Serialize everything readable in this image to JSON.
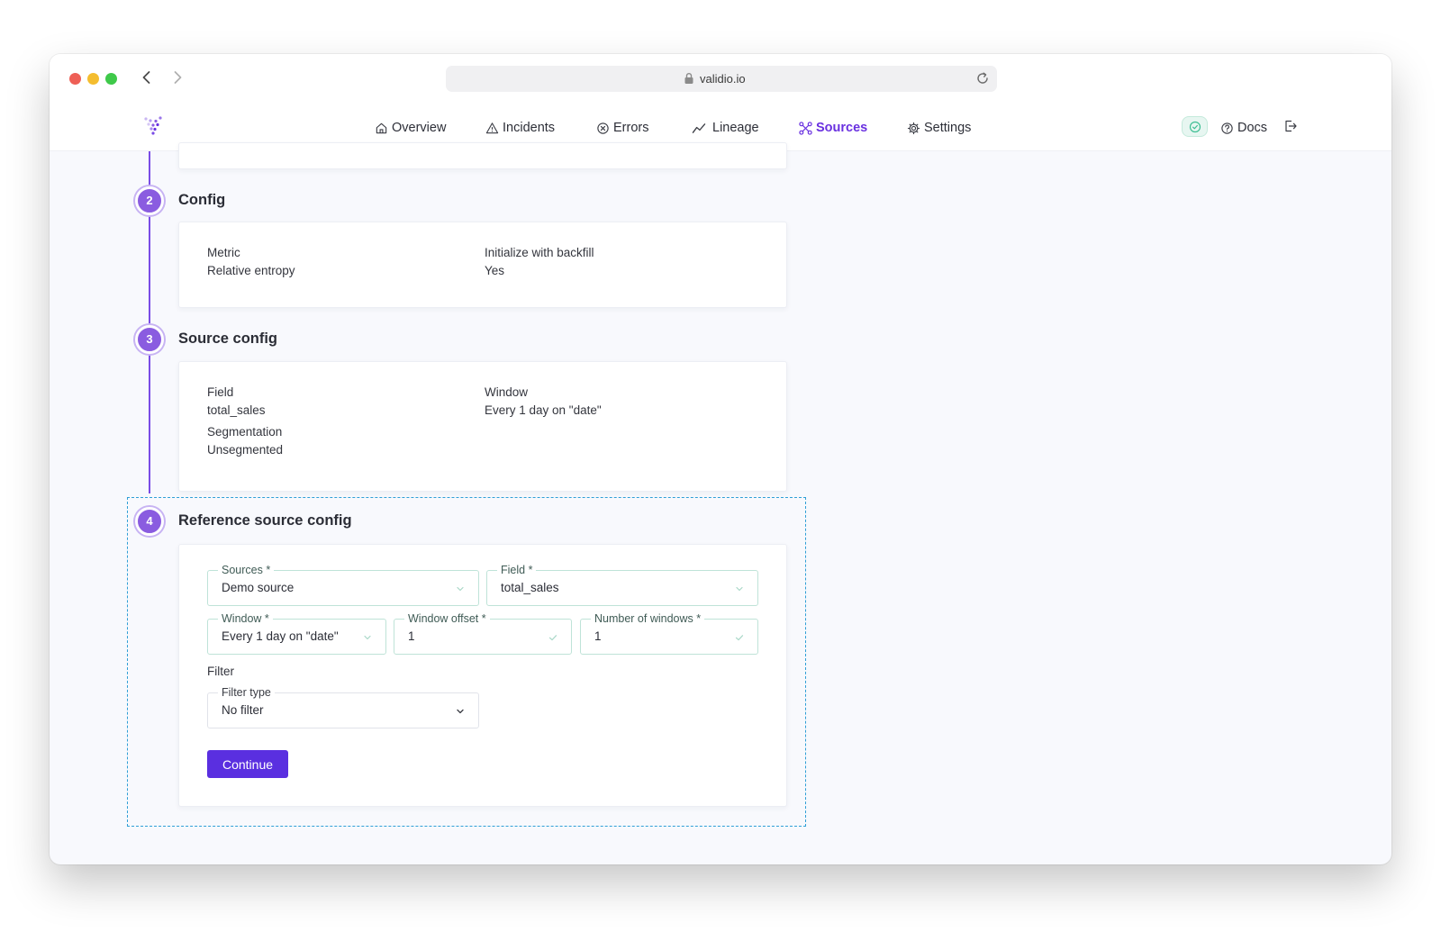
{
  "browser": {
    "url": "validio.io"
  },
  "nav": {
    "items": [
      {
        "label": "Overview",
        "icon": "home-icon"
      },
      {
        "label": "Incidents",
        "icon": "warning-triangle-icon"
      },
      {
        "label": "Errors",
        "icon": "error-circle-icon"
      },
      {
        "label": "Lineage",
        "icon": "lineage-chart-icon"
      },
      {
        "label": "Sources",
        "icon": "sources-network-icon",
        "active": true
      },
      {
        "label": "Settings",
        "icon": "gear-icon"
      }
    ],
    "docs_label": "Docs",
    "accent_color": "#6a31e0"
  },
  "steps": {
    "config": {
      "number": "2",
      "title": "Config",
      "metric_label": "Metric",
      "metric_value": "Relative entropy",
      "backfill_label": "Initialize with backfill",
      "backfill_value": "Yes"
    },
    "source_config": {
      "number": "3",
      "title": "Source config",
      "field_label": "Field",
      "field_value": "total_sales",
      "window_label": "Window",
      "window_value": "Every 1 day on \"date\"",
      "segmentation_label": "Segmentation",
      "segmentation_value": "Unsegmented"
    },
    "reference_source_config": {
      "number": "4",
      "title": "Reference source config",
      "sources_label": "Sources *",
      "sources_value": "Demo source",
      "field_label": "Field *",
      "field_value": "total_sales",
      "window_label": "Window *",
      "window_value": "Every 1 day on \"date\"",
      "window_offset_label": "Window offset *",
      "window_offset_value": "1",
      "number_of_windows_label": "Number of windows *",
      "number_of_windows_value": "1",
      "filter_heading": "Filter",
      "filter_type_label": "Filter type",
      "filter_type_value": "No filter",
      "continue_label": "Continue"
    }
  }
}
